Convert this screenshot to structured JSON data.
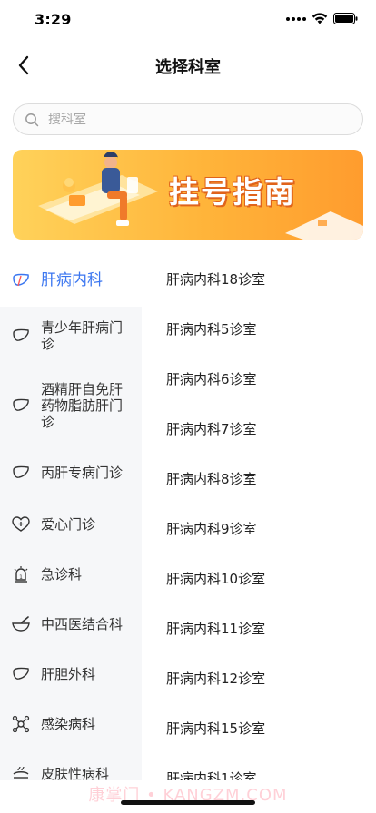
{
  "status_bar": {
    "time": "3:29"
  },
  "nav": {
    "title": "选择科室"
  },
  "search": {
    "placeholder": "搜科室"
  },
  "banner": {
    "title": "挂号指南"
  },
  "sidebar": {
    "items": [
      {
        "label": "肝病内科",
        "icon": "liver-icon",
        "active": true
      },
      {
        "label": "青少年肝病门诊",
        "icon": "liver-icon"
      },
      {
        "label": "酒精肝自免肝药物脂肪肝门诊",
        "icon": "liver-icon"
      },
      {
        "label": "丙肝专病门诊",
        "icon": "liver-icon"
      },
      {
        "label": "爱心门诊",
        "icon": "heart-icon"
      },
      {
        "label": "急诊科",
        "icon": "siren-icon"
      },
      {
        "label": "中西医结合科",
        "icon": "mortar-icon"
      },
      {
        "label": "肝胆外科",
        "icon": "liver-icon"
      },
      {
        "label": "感染病科",
        "icon": "virus-icon"
      },
      {
        "label": "皮肤性病科",
        "icon": "skin-icon"
      }
    ]
  },
  "rooms": [
    "肝病内科18诊室",
    "肝病内科5诊室",
    "肝病内科6诊室",
    "肝病内科7诊室",
    "肝病内科8诊室",
    "肝病内科9诊室",
    "肝病内科10诊室",
    "肝病内科11诊室",
    "肝病内科12诊室",
    "肝病内科15诊室",
    "肝病内科1诊室"
  ],
  "watermark": "康掌门 • KANGZM.COM",
  "colors": {
    "accent": "#3b76f0",
    "banner": "#ffb43a",
    "sidebar_bg": "#f6f7f9"
  }
}
